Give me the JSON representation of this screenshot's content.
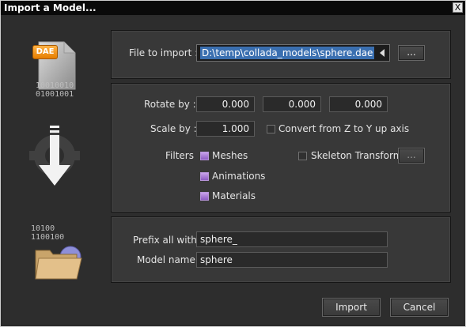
{
  "window": {
    "title": "Import a Model...",
    "close_glyph": "X"
  },
  "icons": {
    "file_badge": "DAE",
    "binary_top": [
      "10010010",
      "01001001"
    ],
    "binary_bottom": [
      "10100",
      "1100100"
    ]
  },
  "file": {
    "label": "File to import :",
    "value": "D:\\temp\\collada_models\\sphere.dae",
    "browse_label": "..."
  },
  "transform": {
    "rotate_label": "Rotate by :",
    "rotate_values": [
      "0.000",
      "0.000",
      "0.000"
    ],
    "scale_label": "Scale by :",
    "scale_value": "1.000",
    "convert_label": "Convert from Z to Y up axis",
    "convert_checked": false
  },
  "filters": {
    "label": "Filters",
    "items": [
      {
        "label": "Meshes",
        "checked": true
      },
      {
        "label": "Animations",
        "checked": true
      },
      {
        "label": "Materials",
        "checked": true
      }
    ],
    "skeleton_label": "Skeleton Transform",
    "skeleton_checked": false,
    "skeleton_button_label": "..."
  },
  "naming": {
    "prefix_label": "Prefix all with :",
    "prefix_value": "sphere_",
    "model_label": "Model name :",
    "model_value": "sphere"
  },
  "actions": {
    "import_label": "Import",
    "cancel_label": "Cancel"
  },
  "colors": {
    "accent_selection": "#3a6fb0",
    "checkbox_checked": "#a273d6",
    "panel_bg": "#383838",
    "window_bg": "#2d2d2d"
  }
}
